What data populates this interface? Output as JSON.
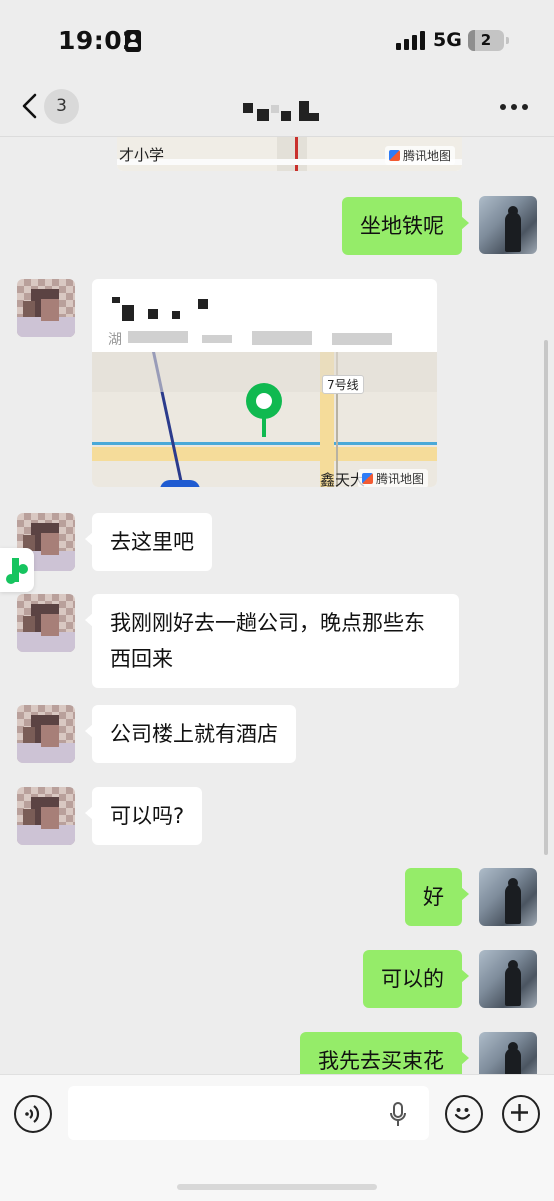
{
  "status_bar": {
    "time": "19:02",
    "network": "5G",
    "battery_level": "2"
  },
  "nav": {
    "unread_count": "3"
  },
  "messages": [
    {
      "side": "right",
      "text": "坐地铁呢"
    },
    {
      "side": "left",
      "type": "location"
    },
    {
      "side": "left",
      "text": "去这里吧"
    },
    {
      "side": "left",
      "text": "我刚刚好去一趟公司，晚点那些东西回来"
    },
    {
      "side": "left",
      "text": "公司楼上就有酒店"
    },
    {
      "side": "left",
      "text": "可以吗?"
    },
    {
      "side": "right",
      "text": "好"
    },
    {
      "side": "right",
      "text": "可以的"
    },
    {
      "side": "right",
      "text": "我先去买束花"
    }
  ],
  "top_map": {
    "label": "才小学",
    "watermark": "腾讯地图"
  },
  "location_card": {
    "address_prefix": "湖",
    "metro_label": "7号线",
    "watermark": "腾讯地图",
    "bottom_label": "鑫天大"
  },
  "colors": {
    "background": "#ededed",
    "outgoing_bubble": "#95ec69",
    "incoming_bubble": "#ffffff",
    "pin": "#10b950"
  }
}
